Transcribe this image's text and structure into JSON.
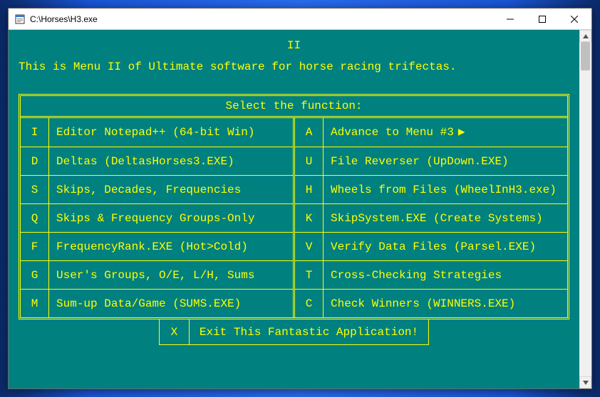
{
  "window": {
    "title": "C:\\Horses\\H3.exe"
  },
  "console": {
    "menu_title": "II",
    "intro": "This is Menu II of Ultimate software for horse racing trifectas.",
    "select_label": "Select the function:",
    "left": [
      {
        "key": "I",
        "desc": "Editor Notepad++ (64-bit Win)"
      },
      {
        "key": "D",
        "desc": "Deltas (DeltasHorses3.EXE)"
      },
      {
        "key": "S",
        "desc": "Skips, Decades, Frequencies"
      },
      {
        "key": "Q",
        "desc": "Skips & Frequency Groups-Only"
      },
      {
        "key": "F",
        "desc": "FrequencyRank.EXE (Hot>Cold)"
      },
      {
        "key": "G",
        "desc": "User's Groups, O/E, L/H, Sums"
      },
      {
        "key": "M",
        "desc": "Sum-up Data/Game (SUMS.EXE)"
      }
    ],
    "right": [
      {
        "key": "A",
        "desc": "Advance to Menu #3",
        "arrow": "▶"
      },
      {
        "key": "U",
        "desc": "File Reverser (UpDown.EXE)"
      },
      {
        "key": "H",
        "desc": "Wheels from Files (WheelInH3.exe)"
      },
      {
        "key": "K",
        "desc": "SkipSystem.EXE (Create Systems)"
      },
      {
        "key": "V",
        "desc": "Verify Data Files (Parsel.EXE)"
      },
      {
        "key": "T",
        "desc": "Cross-Checking Strategies"
      },
      {
        "key": "C",
        "desc": "Check Winners (WINNERS.EXE)"
      }
    ],
    "exit": {
      "key": "X",
      "desc": "Exit This Fantastic Application!"
    }
  }
}
